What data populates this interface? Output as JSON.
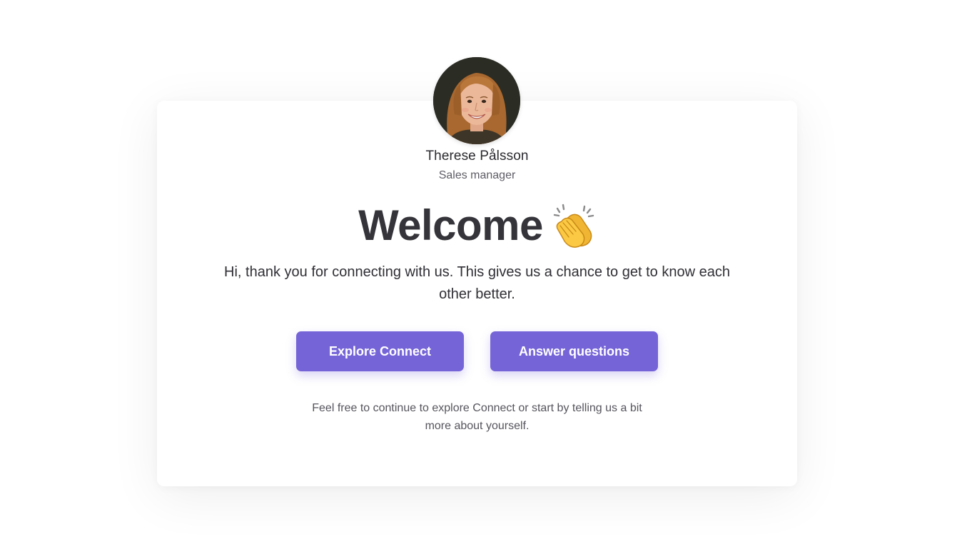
{
  "profile": {
    "name": "Therese Pålsson",
    "role": "Sales manager"
  },
  "welcome": {
    "title": "Welcome",
    "emoji_icon": "clapping-hands-icon",
    "message": "Hi, thank you for connecting with us. This gives us a chance to get to know each other better."
  },
  "actions": {
    "explore_label": "Explore Connect",
    "answer_label": "Answer questions"
  },
  "hint": "Feel free to continue to explore Connect or start by telling us a bit more about yourself.",
  "colors": {
    "accent": "#7564d8",
    "heading": "#34343a",
    "background": "#ffffff"
  }
}
